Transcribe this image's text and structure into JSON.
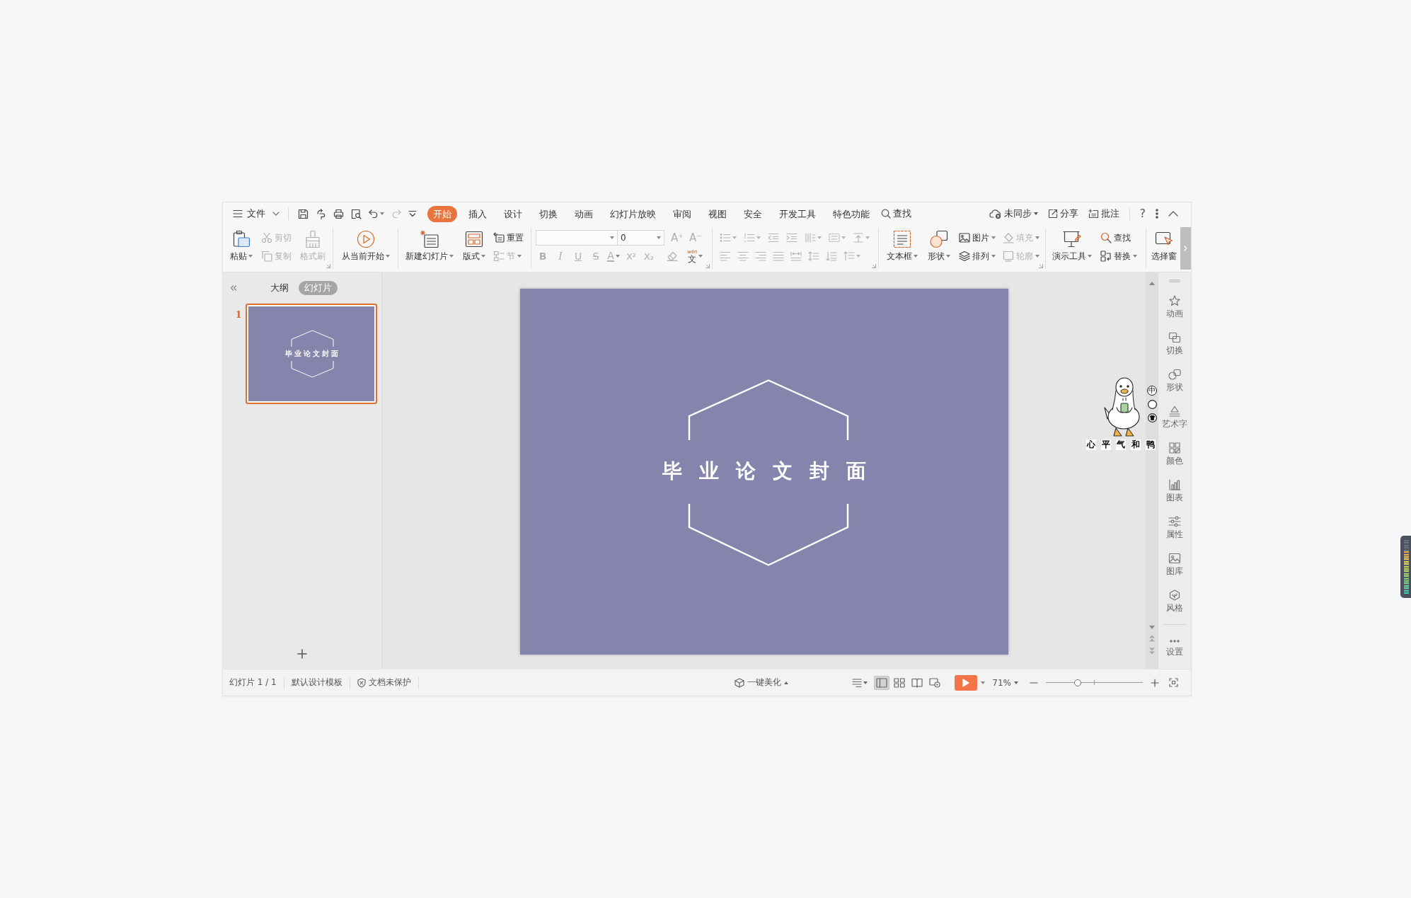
{
  "menu_bar": {
    "file_menu": "文件",
    "tabs": [
      {
        "label": "开始",
        "selected": true
      },
      {
        "label": "插入",
        "selected": false
      },
      {
        "label": "设计",
        "selected": false
      },
      {
        "label": "切换",
        "selected": false
      },
      {
        "label": "动画",
        "selected": false
      },
      {
        "label": "幻灯片放映",
        "selected": false
      },
      {
        "label": "审阅",
        "selected": false
      },
      {
        "label": "视图",
        "selected": false
      },
      {
        "label": "安全",
        "selected": false
      },
      {
        "label": "开发工具",
        "selected": false
      },
      {
        "label": "特色功能",
        "selected": false
      }
    ],
    "search": "查找",
    "sync_status": "未同步",
    "share": "分享",
    "comment": "批注",
    "help": "?"
  },
  "quick_access": {
    "redo": {
      "disabled": true
    }
  },
  "ribbon": {
    "clipboard": {
      "items": [
        {
          "kind": "large",
          "label": "粘贴",
          "dropdown": true,
          "disabled": false
        },
        {
          "kind": "small",
          "label": "剪切",
          "dropdown": false,
          "disabled": true
        },
        {
          "kind": "small",
          "label": "复制",
          "dropdown": false,
          "disabled": true
        },
        {
          "kind": "large",
          "label": "格式刷",
          "dropdown": false,
          "disabled": true
        }
      ]
    },
    "slideshow": {
      "items": [
        {
          "kind": "large",
          "label": "从当前开始",
          "dropdown": true,
          "disabled": false
        }
      ]
    },
    "slides": {
      "items": [
        {
          "kind": "large",
          "label": "新建幻灯片",
          "dropdown": true,
          "disabled": false
        },
        {
          "kind": "large",
          "label": "版式",
          "dropdown": true,
          "disabled": false
        },
        {
          "kind": "small",
          "label": "重置",
          "dropdown": false,
          "disabled": false
        },
        {
          "kind": "small",
          "label": "节",
          "dropdown": true,
          "disabled": true
        }
      ]
    },
    "font": {
      "size_field": {
        "value": "0"
      },
      "size_buttons": [
        {
          "label": "A⁺",
          "disabled": true
        },
        {
          "label": "A⁻",
          "disabled": true
        }
      ],
      "format_buttons": [
        {
          "kind": "bold",
          "label": "B",
          "disabled": true,
          "dropdown": false
        },
        {
          "kind": "italic",
          "label": "I",
          "disabled": true,
          "dropdown": false
        },
        {
          "kind": "underline",
          "label": "U",
          "disabled": true,
          "dropdown": false
        },
        {
          "kind": "strike",
          "label": "S",
          "disabled": true,
          "dropdown": false
        },
        {
          "kind": "color",
          "label": "A",
          "disabled": true,
          "dropdown": true
        },
        {
          "kind": "superscript",
          "label": "X²",
          "disabled": true,
          "dropdown": false
        },
        {
          "kind": "subscript",
          "label": "X₂",
          "disabled": true,
          "dropdown": false
        },
        {
          "kind": "clear",
          "disabled": true
        },
        {
          "kind": "phonetic",
          "label": "文",
          "ruby": "wén",
          "disabled": false,
          "dropdown": true
        }
      ]
    },
    "paragraph": {
      "disabled": true
    },
    "insert": {
      "items": [
        {
          "kind": "large",
          "label": "文本框",
          "dropdown": true,
          "disabled": false
        },
        {
          "kind": "large",
          "label": "形状",
          "dropdown": true,
          "disabled": false
        },
        {
          "kind": "small",
          "label": "图片",
          "dropdown": true,
          "disabled": false
        },
        {
          "kind": "small",
          "label": "排列",
          "dropdown": true,
          "disabled": false
        },
        {
          "kind": "small",
          "label": "填充",
          "dropdown": true,
          "disabled": true
        },
        {
          "kind": "small",
          "label": "轮廓",
          "dropdown": true,
          "disabled": true
        }
      ]
    },
    "tools": {
      "items": [
        {
          "kind": "large",
          "label": "演示工具",
          "dropdown": true,
          "disabled": false
        },
        {
          "kind": "small",
          "label": "查找",
          "dropdown": false,
          "disabled": false
        },
        {
          "kind": "small",
          "label": "替换",
          "dropdown": true,
          "disabled": false
        }
      ]
    },
    "selection": {
      "items": [
        {
          "kind": "large",
          "label": "选择窗",
          "dropdown": false,
          "disabled": false
        }
      ]
    }
  },
  "slide_panel": {
    "view_tabs": [
      {
        "label": "大纲",
        "selected": false
      },
      {
        "label": "幻灯片",
        "selected": true
      }
    ],
    "slides": [
      {
        "number": "1",
        "title": "毕业论文封面",
        "selected": true
      }
    ]
  },
  "slide": {
    "title": "毕业论文封面"
  },
  "task_pane": {
    "items": [
      "动画",
      "切换",
      "形状",
      "艺术字",
      "颜色",
      "图表",
      "属性",
      "图库",
      "风格"
    ],
    "settings": "设置"
  },
  "status_bar": {
    "slide_counter": "幻灯片 1 / 1",
    "template": "默认设计模板",
    "protection": "文档未保护",
    "beautify": "一键美化",
    "views": [
      {
        "selected": true
      },
      {
        "selected": false
      },
      {
        "selected": false
      },
      {
        "selected": false
      }
    ],
    "zoom_percent": "71%",
    "zoom_slider": {
      "level": 0.33
    }
  },
  "ime_widget": {
    "mode": "中",
    "caption": [
      "心",
      "平",
      "气",
      "和",
      "鸭"
    ]
  },
  "desktop_meter": {
    "level": 0.8
  }
}
